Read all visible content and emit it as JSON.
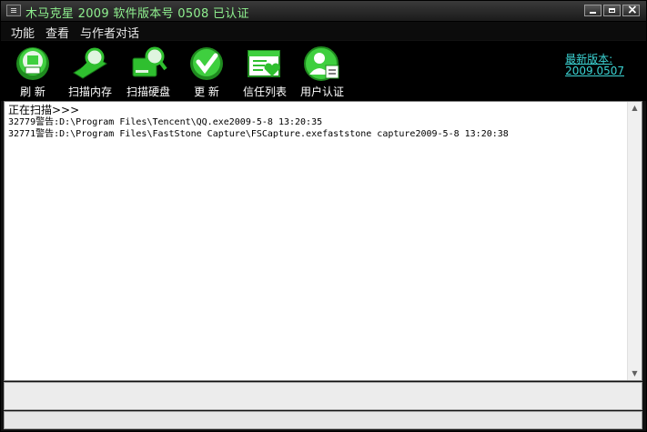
{
  "window": {
    "title": "木马克星 2009 软件版本号 0508  已认证"
  },
  "menu": [
    {
      "label": "功能"
    },
    {
      "label": "查看"
    },
    {
      "label": "与作者对话"
    }
  ],
  "toolbar": {
    "buttons": [
      {
        "label": "刷 新",
        "icon": "refresh-icon"
      },
      {
        "label": "扫描内存",
        "icon": "scan-memory-icon"
      },
      {
        "label": "扫描硬盘",
        "icon": "scan-disk-icon"
      },
      {
        "label": "更 新",
        "icon": "update-icon"
      },
      {
        "label": "信任列表",
        "icon": "trust-list-icon"
      },
      {
        "label": "用户认证",
        "icon": "user-auth-icon"
      }
    ],
    "version_label": "最新版本:",
    "version_value": "2009.0507"
  },
  "log": {
    "header": "正在扫描>>>",
    "lines": [
      "32779警告:D:\\Program Files\\Tencent\\QQ.exe2009-5-8 13:20:35",
      "32771警告:D:\\Program Files\\FastStone Capture\\FSCapture.exefaststone capture2009-5-8 13:20:38"
    ]
  },
  "colors": {
    "title_text": "#8ff08f",
    "link": "#3bd3d3",
    "icon_green": "#2fbf2f"
  }
}
